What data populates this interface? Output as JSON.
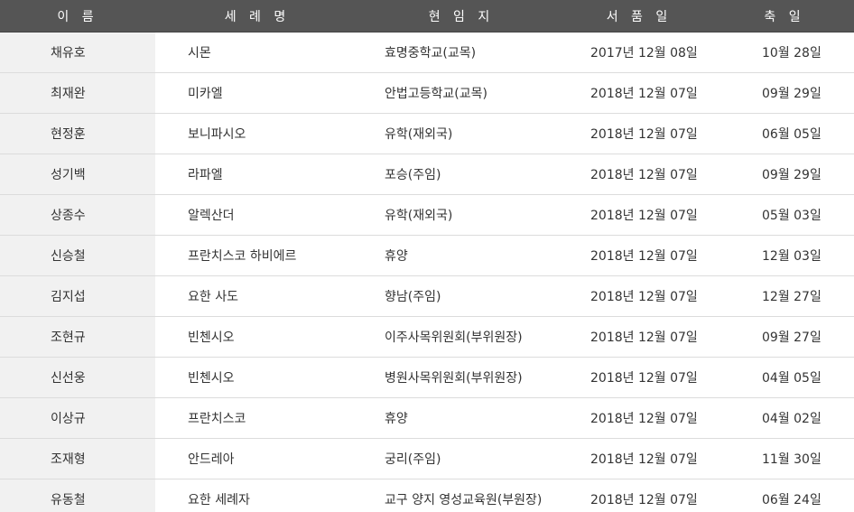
{
  "table": {
    "headers": {
      "name": "이 름",
      "baptism": "세 례 명",
      "assignment": "현 임 지",
      "ordination": "서 품 일",
      "feast": "축 일"
    },
    "rows": [
      {
        "name": "채유호",
        "baptism": "시몬",
        "assignment": "효명중학교(교목)",
        "ordination": "2017년 12월 08일",
        "feast": "10월 28일"
      },
      {
        "name": "최재완",
        "baptism": "미카엘",
        "assignment": "안법고등학교(교목)",
        "ordination": "2018년 12월 07일",
        "feast": "09월 29일"
      },
      {
        "name": "현정훈",
        "baptism": "보니파시오",
        "assignment": "유학(재외국)",
        "ordination": "2018년 12월 07일",
        "feast": "06월 05일"
      },
      {
        "name": "성기백",
        "baptism": "라파엘",
        "assignment": "포승(주임)",
        "ordination": "2018년 12월 07일",
        "feast": "09월 29일"
      },
      {
        "name": "상종수",
        "baptism": "알렉산더",
        "assignment": "유학(재외국)",
        "ordination": "2018년 12월 07일",
        "feast": "05월 03일"
      },
      {
        "name": "신승철",
        "baptism": "프란치스코 하비에르",
        "assignment": "휴양",
        "ordination": "2018년 12월 07일",
        "feast": "12월 03일"
      },
      {
        "name": "김지섭",
        "baptism": "요한 사도",
        "assignment": "향남(주임)",
        "ordination": "2018년 12월 07일",
        "feast": "12월 27일"
      },
      {
        "name": "조현규",
        "baptism": "빈첸시오",
        "assignment": "이주사목위원회(부위원장)",
        "ordination": "2018년 12월 07일",
        "feast": "09월 27일"
      },
      {
        "name": "신선웅",
        "baptism": "빈첸시오",
        "assignment": "병원사목위원회(부위원장)",
        "ordination": "2018년 12월 07일",
        "feast": "04월 05일"
      },
      {
        "name": "이상규",
        "baptism": "프란치스코",
        "assignment": "휴양",
        "ordination": "2018년 12월 07일",
        "feast": "04월 02일"
      },
      {
        "name": "조재형",
        "baptism": "안드레아",
        "assignment": "궁리(주임)",
        "ordination": "2018년 12월 07일",
        "feast": "11월 30일"
      },
      {
        "name": "유동철",
        "baptism": "요한 세례자",
        "assignment": "교구 양지 영성교육원(부원장)",
        "ordination": "2018년 12월 07일",
        "feast": "06월 24일"
      }
    ]
  }
}
